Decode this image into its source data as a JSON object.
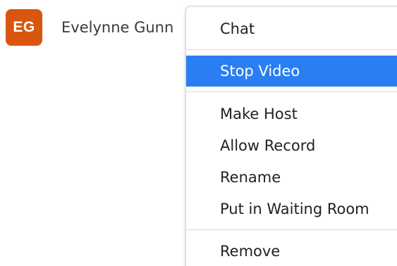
{
  "participant": {
    "initials": "EG",
    "name": "Evelynne Gunn",
    "avatar_color": "#d9560f"
  },
  "menu": {
    "highlight_color": "#2a7ef3",
    "items": [
      {
        "label": "Chat"
      },
      {
        "label": "Stop Video",
        "highlighted": true
      },
      {
        "label": "Make Host"
      },
      {
        "label": "Allow Record"
      },
      {
        "label": "Rename"
      },
      {
        "label": "Put in Waiting Room"
      },
      {
        "label": "Remove"
      }
    ]
  }
}
